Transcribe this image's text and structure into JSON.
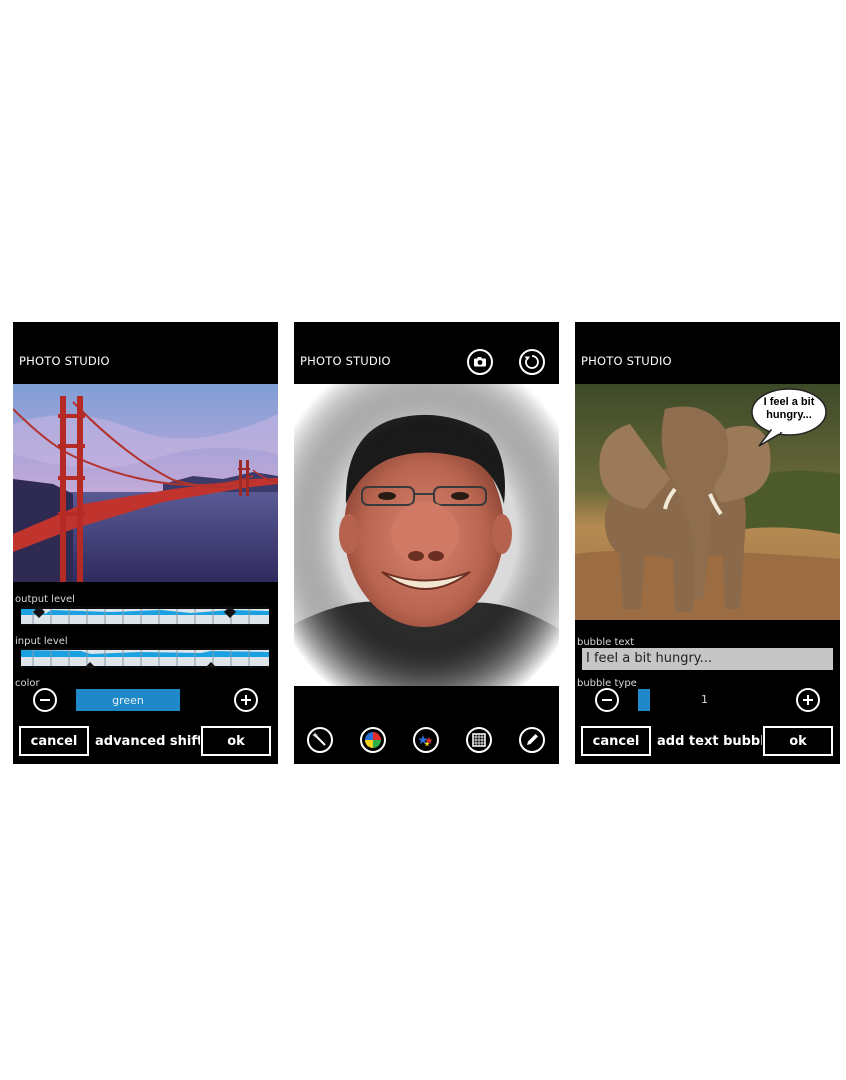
{
  "screens": [
    {
      "app_title": "PHOTO STUDIO",
      "output_level_label": "output level",
      "input_level_label": "input level",
      "color_label": "color",
      "color_value": "green",
      "cancel_label": "cancel",
      "title": "advanced shift c",
      "ok_label": "ok"
    },
    {
      "app_title": "PHOTO STUDIO",
      "header_icons": [
        "camera-icon",
        "rotate-icon"
      ],
      "tool_icons": [
        "magic-wand-icon",
        "color-wheel-icon",
        "stars-effect-icon",
        "grid-frame-icon",
        "pencil-icon"
      ]
    },
    {
      "app_title": "PHOTO STUDIO",
      "speech_bubble": "I feel a bit hungry...",
      "bubble_text_label": "bubble text",
      "bubble_text_value": "I feel a bit hungry...",
      "bubble_type_label": "bubble type",
      "bubble_type_value": "1",
      "cancel_label": "cancel",
      "title": "add text bubble",
      "ok_label": "ok"
    }
  ],
  "colors": {
    "background": "#000000",
    "accent": "#1ba1e2",
    "selected_color": "#1e88c8"
  }
}
